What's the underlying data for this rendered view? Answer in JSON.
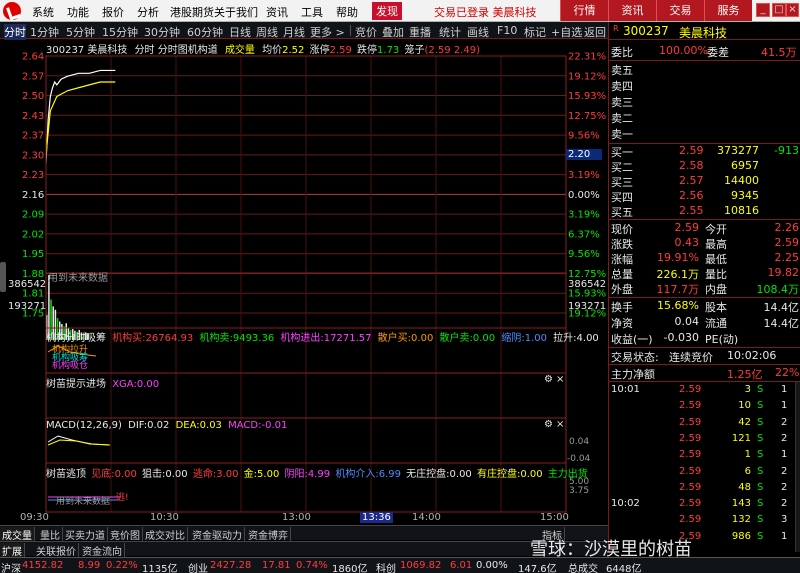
{
  "menu": {
    "items": [
      "系统",
      "功能",
      "报价",
      "分析",
      "港股期货",
      "关于我们",
      "资讯",
      "工具",
      "帮助"
    ],
    "active": "发现",
    "login_status": "交易已登录  美晨科技",
    "right_tabs": [
      "行情",
      "资讯",
      "交易",
      "服务"
    ]
  },
  "toolbar": {
    "periods": [
      "分时",
      "1分钟",
      "5分钟",
      "15分钟",
      "30分钟",
      "60分钟",
      "日线",
      "周线",
      "月线",
      "更多 >"
    ],
    "tools": [
      "竞价",
      "叠加",
      "重播",
      "统计",
      "画线",
      "F10",
      "标记",
      "+自选",
      "返回"
    ]
  },
  "chart_header": {
    "code": "300237",
    "name": "美晨科技",
    "mode": "分时",
    "submode": "分时图机构道",
    "trade_label": "成交量",
    "avg_label": "均价",
    "avg_value": "2.52",
    "limit_up_label": "涨停",
    "limit_up_value": "2.59",
    "limit_down_label": "跌停",
    "limit_down_value": "1.73",
    "custom_label": "笼子",
    "custom_value": "(2.59 2.49)"
  },
  "price_axis": {
    "left": [
      "2.64",
      "2.57",
      "2.50",
      "2.43",
      "2.37",
      "2.30",
      "2.23",
      "2.16",
      "2.09",
      "2.02",
      "1.95",
      "1.88",
      "1.81",
      "1.75"
    ],
    "right": [
      "22.31%",
      "19.12%",
      "15.93%",
      "12.75%",
      "9.56%",
      "6.37%",
      "3.19%",
      "0.00%",
      "3.19%",
      "6.37%",
      "9.56%",
      "12.75%",
      "15.93%",
      "19.12%"
    ],
    "current_price": "2.20",
    "volume_left": [
      "386542",
      "193271"
    ],
    "volume_right": [
      "386542",
      "193271"
    ],
    "future_note": "用到未来数据"
  },
  "chart_data": [
    {
      "type": "line",
      "title": "分时图机构道",
      "series": [
        {
          "name": "价格",
          "x": [
            "09:30",
            "09:31",
            "09:32",
            "09:33",
            "09:34",
            "09:35",
            "09:37",
            "09:40",
            "09:45",
            "09:50",
            "09:55",
            "10:00",
            "10:02"
          ],
          "values": [
            2.27,
            2.42,
            2.5,
            2.53,
            2.55,
            2.54,
            2.56,
            2.57,
            2.58,
            2.58,
            2.59,
            2.59,
            2.59
          ]
        },
        {
          "name": "均价",
          "x": [
            "09:30",
            "09:32",
            "09:35",
            "09:40",
            "09:45",
            "09:50",
            "09:55",
            "10:00",
            "10:02"
          ],
          "values": [
            2.3,
            2.45,
            2.5,
            2.52,
            2.53,
            2.54,
            2.55,
            2.55,
            2.55
          ]
        }
      ],
      "ylim": [
        1.75,
        2.64
      ]
    },
    {
      "type": "bar",
      "title": "成交量",
      "x": [
        "09:30",
        "09:31",
        "09:32",
        "09:33",
        "09:34",
        "09:35",
        "09:36",
        "09:37",
        "09:38",
        "09:39",
        "09:40",
        "09:41",
        "09:42",
        "09:43",
        "09:44",
        "09:45",
        "09:46",
        "09:47",
        "09:48",
        "09:49"
      ],
      "values": [
        150000,
        386542,
        240000,
        200000,
        180000,
        130000,
        110000,
        95000,
        80000,
        100000,
        70000,
        60000,
        65000,
        55000,
        50000,
        60000,
        45000,
        40000,
        45000,
        35000
      ],
      "ylim": [
        0,
        386542
      ]
    }
  ],
  "indicators": {
    "jgcm": {
      "title": "机构分时吸筹",
      "items": [
        {
          "label": "机构买:",
          "value": "26764.93",
          "color": "red"
        },
        {
          "label": "机构卖:",
          "value": "9493.36",
          "color": "green"
        },
        {
          "label": "机构进出:",
          "value": "17271.57",
          "color": "magenta"
        },
        {
          "label": "散户买:",
          "value": "0.00",
          "color": "orange"
        },
        {
          "label": "散户卖:",
          "value": "0.00",
          "color": "green"
        },
        {
          "label": "缩阴:",
          "value": "1.00",
          "color": "blue"
        },
        {
          "label": "拉升:",
          "value": "4.00",
          "color": "white"
        }
      ],
      "overlay": [
        "机构拉升",
        "机构吸筹",
        "机构吸仓"
      ]
    },
    "smts": {
      "title": "树苗提示进场",
      "xga_label": "XGA:",
      "xga_value": "0.00"
    },
    "macd": {
      "title": "MACD(12,26,9)",
      "dif_label": "DIF:",
      "dif": "0.02",
      "dea_label": "DEA:",
      "dea": "0.03",
      "macd_label": "MACD:",
      "macd": "-0.01",
      "axis": [
        "0.04",
        "-0.04"
      ]
    },
    "smtd": {
      "title": "树苗逃顶",
      "items": [
        {
          "label": "见底:",
          "value": "0.00",
          "color": "red"
        },
        {
          "label": "狙击:",
          "value": "0.00",
          "color": "white"
        },
        {
          "label": "逃命:",
          "value": "3.00",
          "color": "red"
        },
        {
          "label": "金:",
          "value": "5.00",
          "color": "yellow"
        },
        {
          "label": "阴阳:",
          "value": "4.99",
          "color": "magenta"
        },
        {
          "label": "机构介入:",
          "value": "6.99",
          "color": "blue"
        },
        {
          "label": "无庄控盘:",
          "value": "0.00",
          "color": "white"
        },
        {
          "label": "有庄控盘:",
          "value": "0.00",
          "color": "yellow"
        },
        {
          "label": "主力出货",
          "value": "",
          "color": "green"
        }
      ],
      "axis": [
        "5.00",
        "3.75"
      ],
      "note": "用到未来数据",
      "tiny": "逃!"
    }
  },
  "time_axis": [
    "09:30",
    "10:30",
    "13:00",
    "13:36",
    "14:00",
    "15:00"
  ],
  "time_axis_highlight": "13:36",
  "bottom_tabs": [
    "成交量",
    "量比",
    "买卖力道",
    "竞价图",
    "成交对比",
    "资金驱动力",
    "资金博弈"
  ],
  "bottom_tabs2": [
    "扩展",
    "关联报价",
    "资金流向"
  ],
  "bottom_tab_extra": "指标",
  "quote": {
    "code_prefix": "R",
    "code": "300237",
    "name": "美晨科技",
    "weibi_label": "委比",
    "weibi": "100.00%",
    "weicha_label": "委差",
    "weicha": "41.5万",
    "sell": [
      {
        "label": "卖五",
        "price": "",
        "vol": ""
      },
      {
        "label": "卖四",
        "price": "",
        "vol": ""
      },
      {
        "label": "卖三",
        "price": "",
        "vol": ""
      },
      {
        "label": "卖二",
        "price": "",
        "vol": ""
      },
      {
        "label": "卖一",
        "price": "",
        "vol": ""
      }
    ],
    "buy": [
      {
        "label": "买一",
        "price": "2.59",
        "vol": "373277",
        "chg": "-913"
      },
      {
        "label": "买二",
        "price": "2.58",
        "vol": "6957",
        "chg": ""
      },
      {
        "label": "买三",
        "price": "2.57",
        "vol": "14400",
        "chg": ""
      },
      {
        "label": "买四",
        "price": "2.56",
        "vol": "9345",
        "chg": ""
      },
      {
        "label": "买五",
        "price": "2.55",
        "vol": "10816",
        "chg": ""
      }
    ],
    "stats": [
      {
        "l1": "现价",
        "v1": "2.59",
        "l2": "今开",
        "v2": "2.26"
      },
      {
        "l1": "涨跌",
        "v1": "0.43",
        "l2": "最高",
        "v2": "2.59"
      },
      {
        "l1": "涨幅",
        "v1": "19.91%",
        "l2": "最低",
        "v2": "2.25"
      },
      {
        "l1": "总量",
        "v1": "226.1万",
        "l2": "量比",
        "v2": "19.82"
      },
      {
        "l1": "外盘",
        "v1": "117.7万",
        "l2": "内盘",
        "v2": "108.4万"
      }
    ],
    "stats2": [
      {
        "l1": "换手",
        "v1": "15.68%",
        "l2": "股本",
        "v2": "14.4亿"
      },
      {
        "l1": "净资",
        "v1": "0.04",
        "l2": "流通",
        "v2": "14.4亿"
      },
      {
        "l1": "收益(一)",
        "v1": "-0.030",
        "l2": "PE(动)",
        "v2": ""
      }
    ],
    "trade_status_label": "交易状态:",
    "trade_status": "连续竞价",
    "trade_time": "10:02:06",
    "main_flow_label": "主力净额",
    "main_flow_value": "1.25亿",
    "main_flow_pct": "22%",
    "ticks": [
      {
        "time": "10:01",
        "price": "2.59",
        "vol": "3",
        "side": "S",
        "n": "1"
      },
      {
        "time": "",
        "price": "2.59",
        "vol": "10",
        "side": "S",
        "n": "1"
      },
      {
        "time": "",
        "price": "2.59",
        "vol": "42",
        "side": "S",
        "n": "2"
      },
      {
        "time": "",
        "price": "2.59",
        "vol": "121",
        "side": "S",
        "n": "2"
      },
      {
        "time": "",
        "price": "2.59",
        "vol": "1",
        "side": "S",
        "n": "1"
      },
      {
        "time": "",
        "price": "2.59",
        "vol": "6",
        "side": "S",
        "n": "2"
      },
      {
        "time": "",
        "price": "2.59",
        "vol": "48",
        "side": "S",
        "n": "2"
      },
      {
        "time": "10:02",
        "price": "2.59",
        "vol": "143",
        "side": "S",
        "n": "2"
      },
      {
        "time": "",
        "price": "2.59",
        "vol": "132",
        "side": "S",
        "n": "3"
      },
      {
        "time": "",
        "price": "2.59",
        "vol": "986",
        "side": "S",
        "n": "1"
      }
    ]
  },
  "status_bar": {
    "sh_label": "沪深",
    "sh_value": "4152.82",
    "sh_chg": "8.99",
    "sh_pct": "0.22%",
    "sh_amt": "1135亿",
    "cy_label": "创业",
    "cy_value": "2427.28",
    "cy_chg": "17.81",
    "cy_pct": "0.74%",
    "cy_amt": "1860亿",
    "kc_label": "科创",
    "kc_value": "1069.82",
    "kc_chg": "6.01",
    "kc_pct": "0.00%",
    "kc_amt": "147.6亿",
    "deal_label": "总成交",
    "deal_value": "6448亿"
  },
  "watermark": "雪球：沙漠里的树苗"
}
